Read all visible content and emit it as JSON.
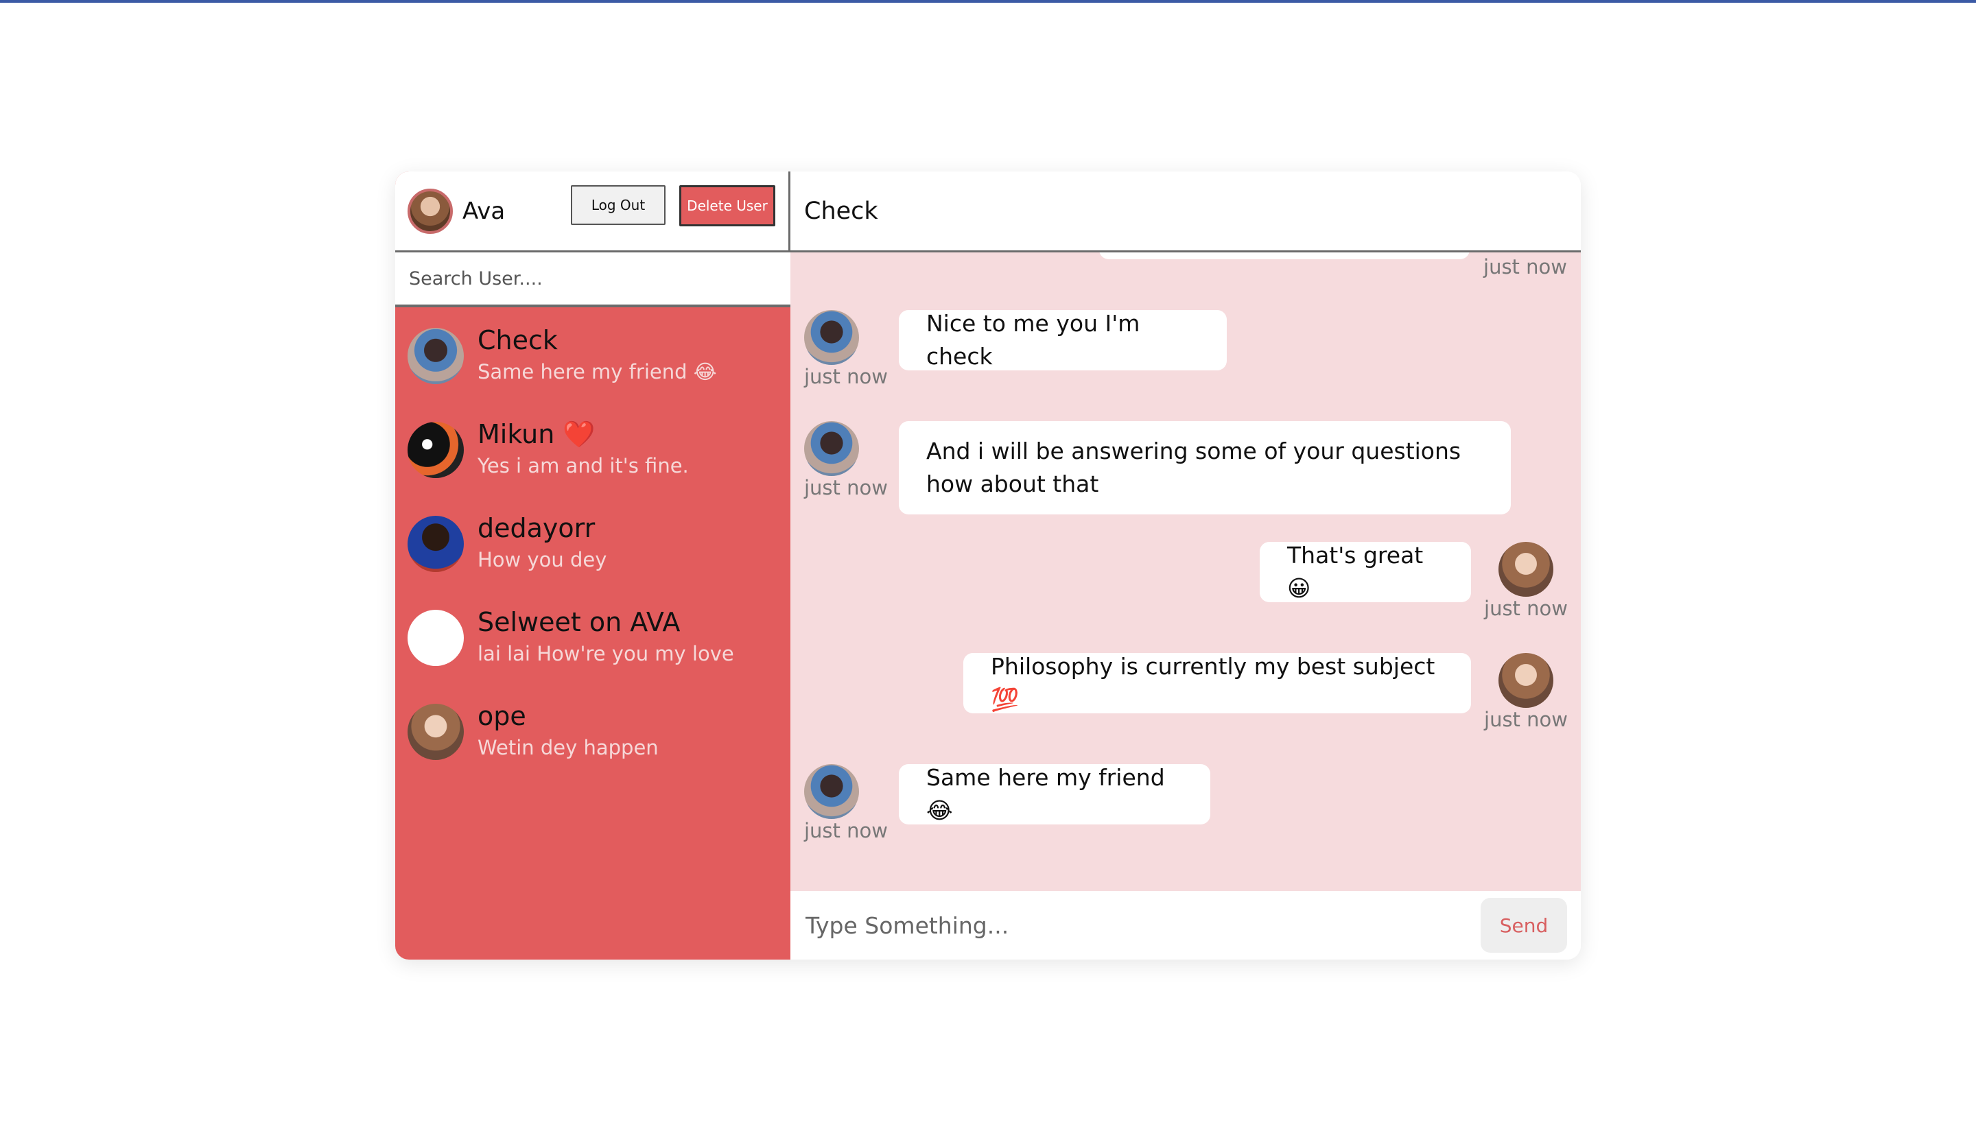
{
  "me": {
    "name": "Ava",
    "logout_label": "Log Out",
    "delete_label": "Delete User"
  },
  "search": {
    "placeholder": "Search User...."
  },
  "users": [
    {
      "name": "Check",
      "last": "Same here my friend 😂"
    },
    {
      "name": "Mikun ❤️",
      "last": "Yes i am and it's fine."
    },
    {
      "name": "dedayorr",
      "last": "How you dey"
    },
    {
      "name": "Selweet on AVA",
      "last": "lai lai How're you my love"
    },
    {
      "name": "ope",
      "last": "Wetin dey happen"
    }
  ],
  "chat": {
    "title": "Check",
    "top_time": "just now",
    "messages": [
      {
        "from": "other",
        "text": "Nice to me you I'm check",
        "time": "just now"
      },
      {
        "from": "other",
        "text": "And i will be answering some of your questions how about that",
        "time": "just now"
      },
      {
        "from": "me",
        "text": "That's great 😀",
        "time": "just now"
      },
      {
        "from": "me",
        "text": "Philosophy is currently my best subject 💯",
        "time": "just now"
      },
      {
        "from": "other",
        "text": "Same here my friend 😂",
        "time": "just now"
      }
    ]
  },
  "composer": {
    "placeholder": "Type Something...",
    "send_label": "Send"
  },
  "colors": {
    "accent": "#e25c5d",
    "chat_bg": "#f6dbdd",
    "top_border": "#3b5aa5"
  }
}
